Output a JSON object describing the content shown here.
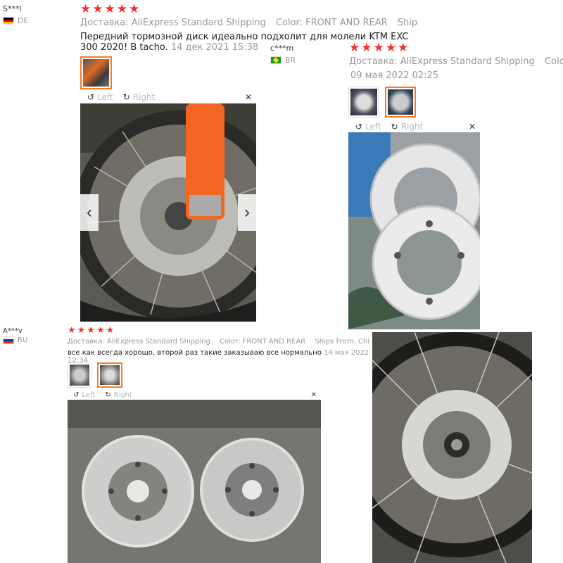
{
  "reviews": [
    {
      "user": "S***l",
      "country": "DE",
      "stars": "★★★★★",
      "shipping": "Доставка: AliExpress Standard Shipping",
      "color": "Color: FRONT AND REAR",
      "ships_from": "Ships From: Chir",
      "text": "Передний тормозной диск идеально подхолит для молели KTM EXC 300 2020! В tacho.",
      "date": "14 дек 2021 15:38",
      "viewer": {
        "left": "Left",
        "right": "Right",
        "close": "✕"
      },
      "nav": {
        "prev": "‹",
        "next": "›"
      }
    },
    {
      "user": "c***m",
      "country": "BR",
      "stars": "★★★★★",
      "shipping": "Доставка: AliExpress Standard Shipping",
      "color": "Color: FRON",
      "date": "09 мая 2022 02:25",
      "viewer": {
        "left": "Left",
        "right": "Right",
        "close": "✕"
      }
    },
    {
      "user": "A***v",
      "country": "RU",
      "stars": "★★★★★",
      "shipping": "Доставка: AliExpress Standard Shipping",
      "color": "Color: FRONT AND REAR",
      "ships_from": "Ships From: China",
      "text": "все как всегда хорошо, второй раз такие заказываю все нормально",
      "date": "14 мая 2022 12:34",
      "viewer": {
        "left": "Left",
        "right": "Right",
        "close": "✕"
      }
    }
  ],
  "colors": {
    "star": "#f52f2f",
    "active_thumb": "#ff7a1f",
    "meta": "#999999"
  }
}
